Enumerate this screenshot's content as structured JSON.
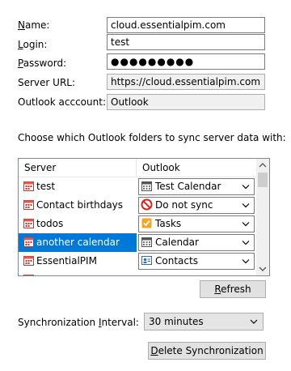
{
  "labels": {
    "name": "Name:",
    "login": "Login:",
    "password": "Password:",
    "server_url": "Server URL:",
    "outlook_account": "Outlook acccount:"
  },
  "fields": {
    "name": "cloud.essentialpim.com",
    "login": "test",
    "password": "●●●●●●●●●",
    "server_url": "https://cloud.essentialpim.com",
    "outlook_account": "Outlook"
  },
  "sync_prompt": "Choose which Outlook folders to sync server data with:",
  "table": {
    "headers": {
      "server": "Server",
      "outlook": "Outlook"
    },
    "rows": [
      {
        "server": "test",
        "outlook": "Test Calendar",
        "outlook_icon": "calendar-icon"
      },
      {
        "server": "Contact birthdays",
        "outlook": "Do not sync",
        "outlook_icon": "no-sync-icon"
      },
      {
        "server": "todos",
        "outlook": "Tasks",
        "outlook_icon": "tasks-icon"
      },
      {
        "server": "another calendar",
        "outlook": "Calendar",
        "outlook_icon": "calendar-icon",
        "selected": true
      },
      {
        "server": "EssentialPIM",
        "outlook": "Contacts",
        "outlook_icon": "contacts-icon"
      }
    ]
  },
  "buttons": {
    "refresh": "Refresh",
    "delete_sync": "Delete Synchronization"
  },
  "interval": {
    "label": "Synchronization Interval:",
    "value": "30 minutes"
  },
  "colors": {
    "selection": "#0078d7",
    "calendar_icon": "#d9534f"
  }
}
